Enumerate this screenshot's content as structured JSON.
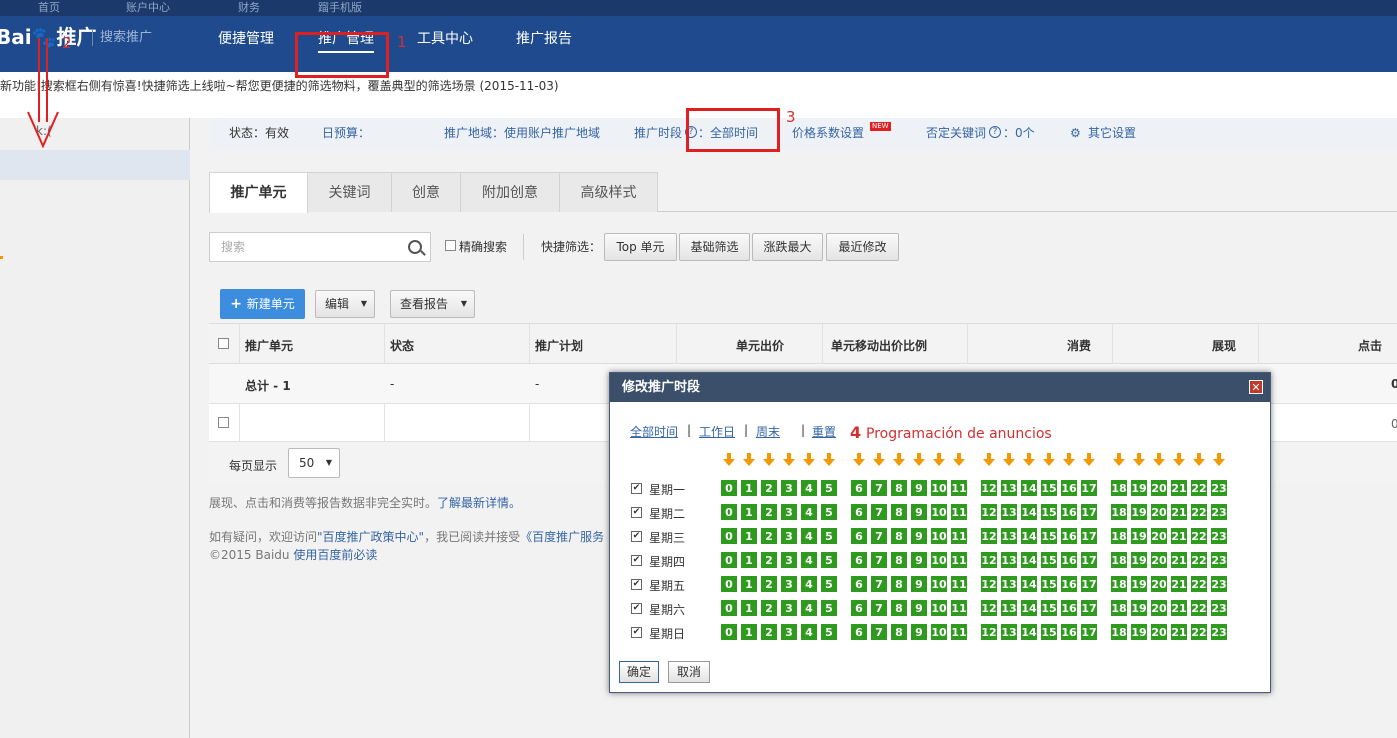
{
  "topstrip": {
    "items": [
      "首页",
      "账户中心",
      "财务",
      "蹓手机版"
    ]
  },
  "header": {
    "logo": "Bai🐾推广",
    "logo_sub": "搜索推广",
    "nav": [
      "便捷管理",
      "推广管理",
      "工具中心",
      "推广报告"
    ]
  },
  "notice": "新功能!搜索框右侧有惊喜!快捷筛选上线啦~帮您更便捷的筛选物料，覆盖典型的筛选场景 (2015-11-03)",
  "sidebar": {
    "label": "k:("
  },
  "status_bar": {
    "status": "状态：有效",
    "budget": "日预算：",
    "region": "推广地域：使用账户推广地域",
    "schedule_label": "推广时段",
    "schedule_value": "：全部时间",
    "price_factor": "价格系数设置",
    "new_badge": "NEW",
    "negative_kw": "否定关键词",
    "negative_kw_value": "：0个",
    "other": "其它设置"
  },
  "tabs": [
    "推广单元",
    "关键词",
    "创意",
    "附加创意",
    "高级样式"
  ],
  "search": {
    "placeholder": "搜索",
    "exact_label": "精确搜索"
  },
  "quick_filter": {
    "label": "快捷筛选：",
    "buttons": [
      "Top 单元",
      "基础筛选",
      "涨跌最大",
      "最近修改"
    ]
  },
  "actions": {
    "new_unit": "新建单元",
    "edit": "编辑",
    "view_report": "查看报告"
  },
  "table": {
    "headers": [
      "推广单元",
      "状态",
      "推广计划",
      "单元出价",
      "单元移动出价比例",
      "消费",
      "展现",
      "点击"
    ],
    "total_row": [
      "总计 - 1",
      "-",
      "-",
      "0"
    ],
    "row1": [
      "",
      "",
      "",
      "0"
    ]
  },
  "pagination": {
    "label": "每页显示",
    "value": "50"
  },
  "footer": {
    "note": "展现、点击和消费等报告数据非完全实时。",
    "note_link": "了解最新详情。",
    "line1_a": "如有疑问，欢迎访问",
    "line1_link": "\"百度推广政策中心\"",
    "line1_b": "，我已阅读并接受",
    "line1_link2": "《百度推广服务",
    "line2_a": "©2015 Baidu",
    "line2_link": "使用百度前必读"
  },
  "annotations": {
    "a1": "1",
    "a2": "2",
    "a3": "3",
    "a4_num": "4",
    "a4_text": "Programación de anuncios"
  },
  "modal": {
    "title": "修改推广时段",
    "links": [
      "全部时间",
      "工作日",
      "周末",
      "重置"
    ],
    "days": [
      "星期一",
      "星期二",
      "星期三",
      "星期四",
      "星期五",
      "星期六",
      "星期日"
    ],
    "hours": [
      "0",
      "1",
      "2",
      "3",
      "4",
      "5",
      "6",
      "7",
      "8",
      "9",
      "10",
      "11",
      "12",
      "13",
      "14",
      "15",
      "16",
      "17",
      "18",
      "19",
      "20",
      "21",
      "22",
      "23"
    ],
    "ok": "确定",
    "cancel": "取消"
  },
  "colors": {
    "nav_bg": "#1f4b8e",
    "hour_cell": "#2e9a1e",
    "arrow": "#f39800",
    "annotation": "#e02020"
  }
}
